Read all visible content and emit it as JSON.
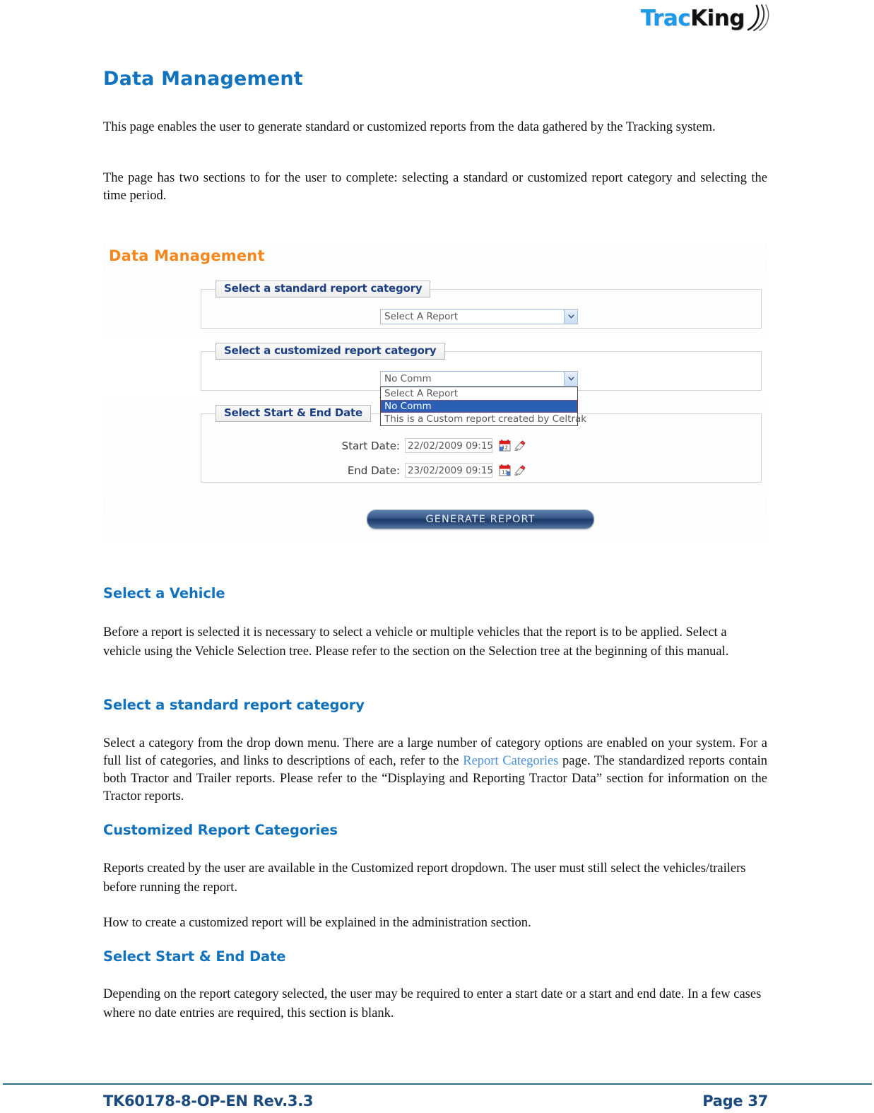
{
  "header": {
    "logo": {
      "part1": "Trac",
      "part2": "K",
      "part3": "ing",
      "icon": "signal-waves-icon"
    }
  },
  "document": {
    "title": "Data Management",
    "intro_paragraph_1": "This page enables the user to generate standard or customized reports from the data gathered by the Tracking system.",
    "intro_paragraph_2": "The page has two sections to for the user to complete: selecting a standard or customized report category and selecting the time period.",
    "sections": [
      {
        "heading": "Select a Vehicle",
        "body": "Before a report is selected it is necessary to select a vehicle or multiple vehicles that the report is to be applied. Select a vehicle using the Vehicle Selection tree. Please refer to the section on the Selection tree at the beginning of this manual."
      },
      {
        "heading": "Select a standard report category",
        "body_before_link": "Select a category from the drop down menu. There are a large number of category options are enabled on your system. For a full list of categories, and links to descriptions of each, refer to the ",
        "link_text": "Report Categories",
        "body_after_link": " page. The standardized reports contain both Tractor and Trailer reports. Please refer to the “Displaying and Reporting Tractor Data” section for information on the Tractor reports."
      },
      {
        "heading": "Customized Report Categories",
        "body": "Reports created by the user are available in the Customized report dropdown. The user must still select the vehicles/trailers before running the report.",
        "body_2": "How to create a customized report will be explained in the administration section."
      },
      {
        "heading": "Select Start & End Date",
        "body": "Depending on the report category selected, the user may be required to enter a start date or a start and end date. In a few cases where no date entries are required, this section is blank."
      }
    ]
  },
  "screenshot": {
    "title": "Data Management",
    "standard_section": {
      "legend": "Select a standard report category",
      "select_value": "Select A Report"
    },
    "customized_section": {
      "legend": "Select a customized report category",
      "select_value": "No Comm",
      "options": [
        "Select A Report",
        "No Comm",
        "This is a Custom report created by Celtrak"
      ],
      "selected_index": 1
    },
    "date_section": {
      "legend": "Select Start & End Date",
      "start_label": "Start Date:",
      "start_value": "22/02/2009 09:15",
      "end_label": "End Date:",
      "end_value": "23/02/2009 09:15",
      "calendar_icon": "calendar-icon",
      "clear_icon": "eraser-icon"
    },
    "generate_button": "GENERATE REPORT"
  },
  "footer": {
    "doc_ref": "TK60178-8-OP-EN Rev.3.3",
    "page": "Page  37"
  },
  "colors": {
    "heading_blue": "#1272bc",
    "screenshot_orange": "#f3871d",
    "footer_navy": "#1b4a7e",
    "footer_rule": "#2e6b8e",
    "legend_navy": "#1c3f82",
    "dropdown_highlight": "#2b5fb5",
    "link_blue": "#4a90d9"
  }
}
